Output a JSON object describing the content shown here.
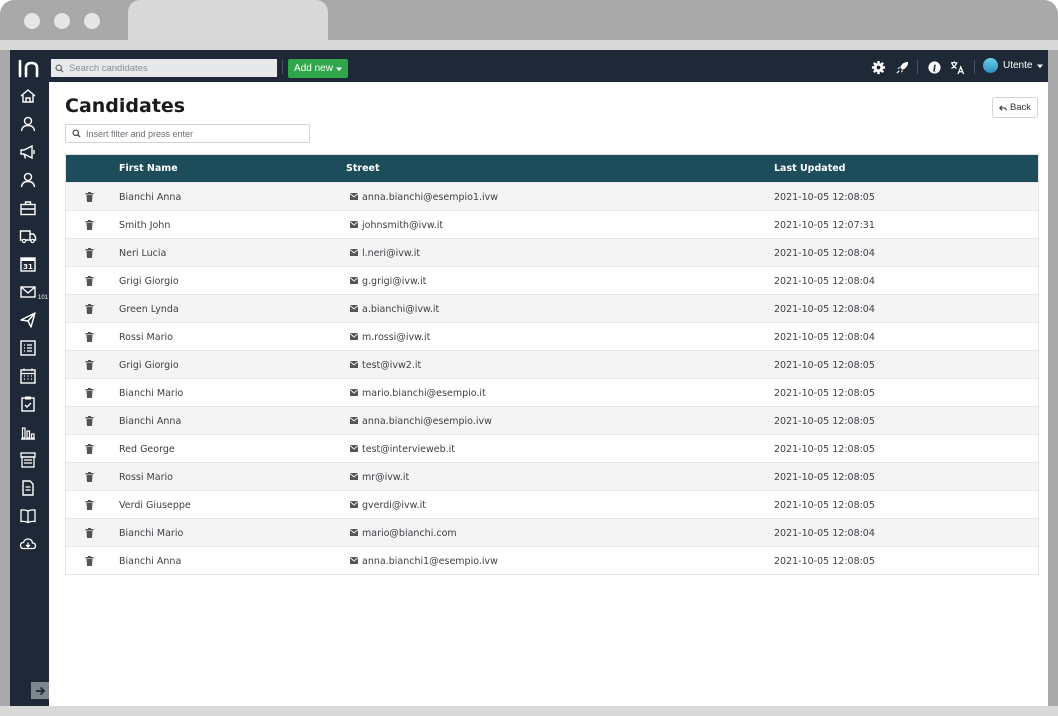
{
  "topbar": {
    "search_placeholder": "Search candidates",
    "add_new_label": "Add new",
    "user_label": "Utente"
  },
  "page": {
    "title": "Candidates",
    "filter_placeholder": "Insert filter and press enter",
    "back_label": "Back"
  },
  "sidebar": {
    "mail_badge": "101"
  },
  "table": {
    "columns": [
      "First Name",
      "Street",
      "Last Updated"
    ],
    "rows": [
      {
        "name": "Bianchi Anna",
        "email": "anna.bianchi@esempio1.ivw",
        "updated": "2021-10-05 12:08:05"
      },
      {
        "name": "Smith John",
        "email": "johnsmith@ivw.it",
        "updated": "2021-10-05 12:07:31"
      },
      {
        "name": "Neri Lucia",
        "email": "l.neri@ivw.it",
        "updated": "2021-10-05 12:08:04"
      },
      {
        "name": "Grigi Giorgio",
        "email": "g.grigi@ivw.it",
        "updated": "2021-10-05 12:08:04"
      },
      {
        "name": "Green Lynda",
        "email": "a.bianchi@ivw.it",
        "updated": "2021-10-05 12:08:04"
      },
      {
        "name": "Rossi Mario",
        "email": "m.rossi@ivw.it",
        "updated": "2021-10-05 12:08:04"
      },
      {
        "name": "Grigi Giorgio",
        "email": "test@ivw2.it",
        "updated": "2021-10-05 12:08:05"
      },
      {
        "name": "Bianchi Mario",
        "email": "mario.bianchi@esempio.it",
        "updated": "2021-10-05 12:08:05"
      },
      {
        "name": "Bianchi Anna",
        "email": "anna.bianchi@esempio.ivw",
        "updated": "2021-10-05 12:08:05"
      },
      {
        "name": "Red George",
        "email": "test@intervieweb.it",
        "updated": "2021-10-05 12:08:05"
      },
      {
        "name": "Rossi Mario",
        "email": "mr@ivw.it",
        "updated": "2021-10-05 12:08:05"
      },
      {
        "name": "Verdi Giuseppe",
        "email": "gverdi@ivw.it",
        "updated": "2021-10-05 12:08:05"
      },
      {
        "name": "Bianchi Mario",
        "email": "mario@bianchi.com",
        "updated": "2021-10-05 12:08:04"
      },
      {
        "name": "Bianchi Anna",
        "email": "anna.bianchi1@esempio.ivw",
        "updated": "2021-10-05 12:08:05"
      }
    ]
  },
  "colors": {
    "sidebar_bg": "#1f2836",
    "table_header_bg": "#1d4c5b",
    "add_button_bg": "#2fa64a"
  }
}
